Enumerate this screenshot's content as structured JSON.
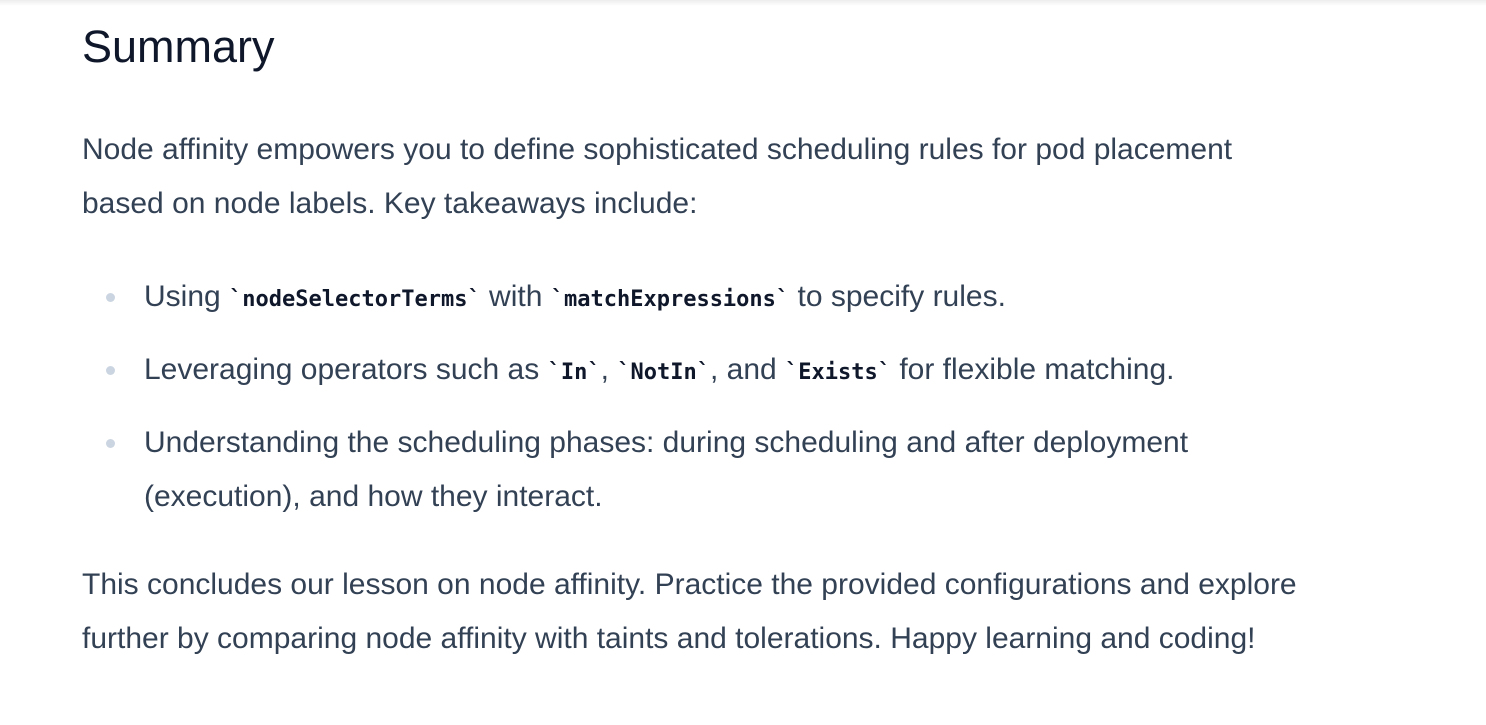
{
  "heading": "Summary",
  "intro": "Node affinity empowers you to define sophisticated scheduling rules for pod placement based on node labels. Key takeaways include:",
  "takeaways": [
    {
      "t1": "Using ",
      "c1": "`nodeSelectorTerms`",
      "t2": " with ",
      "c2": "`matchExpressions`",
      "t3": " to specify rules."
    },
    {
      "t1": "Leveraging operators such as ",
      "c1": "`In`",
      "t2": ", ",
      "c2": "`NotIn`",
      "t3": ", and ",
      "c3": "`Exists`",
      "t4": " for flexible matching."
    },
    {
      "t1": "Understanding the scheduling phases: during scheduling and after deployment (execution), and how they interact."
    }
  ],
  "closing": "This concludes our lesson on node affinity. Practice the provided configurations and explore further by comparing node affinity with taints and tolerations. Happy learning and coding!"
}
